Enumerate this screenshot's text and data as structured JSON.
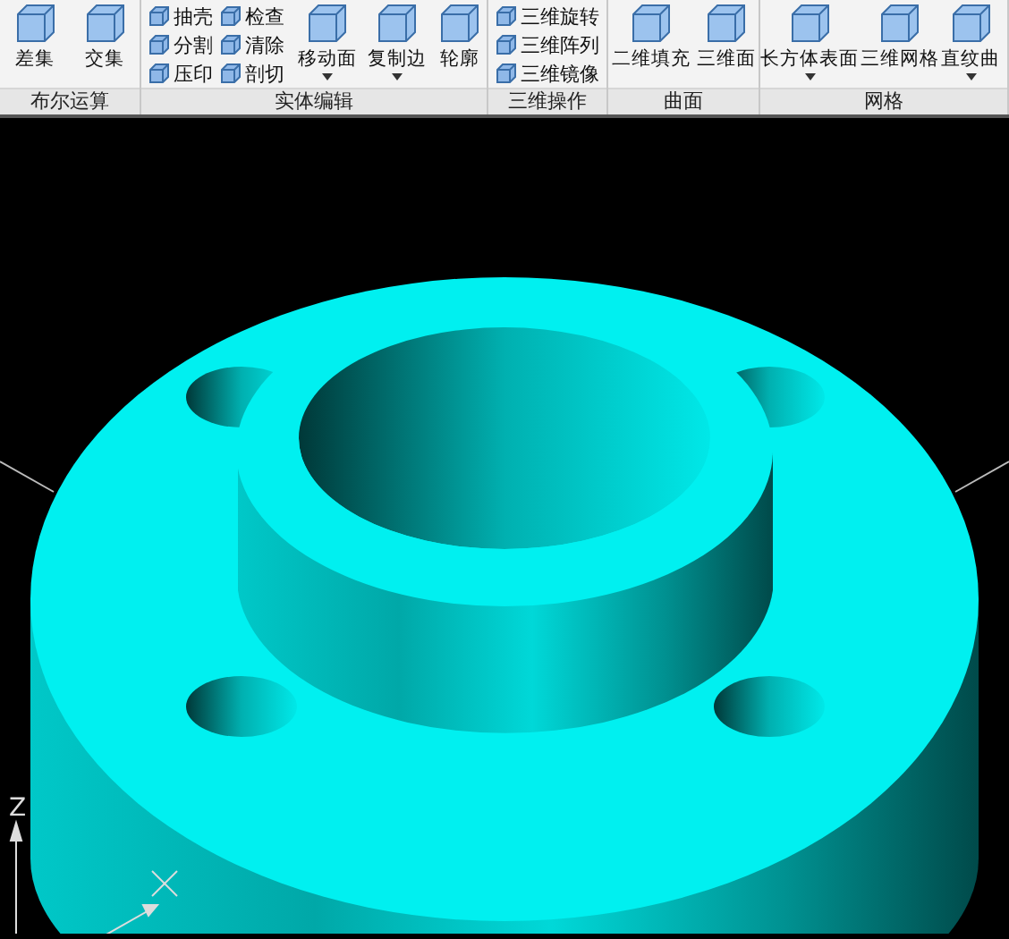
{
  "ribbon": {
    "panels": [
      {
        "title": "布尔运算",
        "large_buttons": [
          {
            "label": "差集",
            "dropdown": false
          },
          {
            "label": "交集",
            "dropdown": false
          }
        ]
      },
      {
        "title": "实体编辑",
        "small_buttons": [
          {
            "label": "抽壳"
          },
          {
            "label": "分割"
          },
          {
            "label": "压印"
          },
          {
            "label": "检查"
          },
          {
            "label": "清除"
          },
          {
            "label": "剖切"
          }
        ],
        "large_buttons": [
          {
            "label": "移动面",
            "dropdown": true
          },
          {
            "label": "复制边",
            "dropdown": true
          },
          {
            "label": "轮廓",
            "dropdown": false
          }
        ]
      },
      {
        "title": "三维操作",
        "small_buttons": [
          {
            "label": "三维旋转"
          },
          {
            "label": "三维阵列"
          },
          {
            "label": "三维镜像"
          }
        ]
      },
      {
        "title": "曲面",
        "large_buttons": [
          {
            "label": "二维填充",
            "dropdown": false
          },
          {
            "label": "三维面",
            "dropdown": false
          }
        ]
      },
      {
        "title": "网格",
        "large_buttons": [
          {
            "label": "长方体表面",
            "dropdown": true
          },
          {
            "label": "三维网格",
            "dropdown": false
          },
          {
            "label": "直纹曲",
            "dropdown": true
          }
        ]
      }
    ]
  },
  "viewport": {
    "ucs_axis_label": "Z"
  }
}
